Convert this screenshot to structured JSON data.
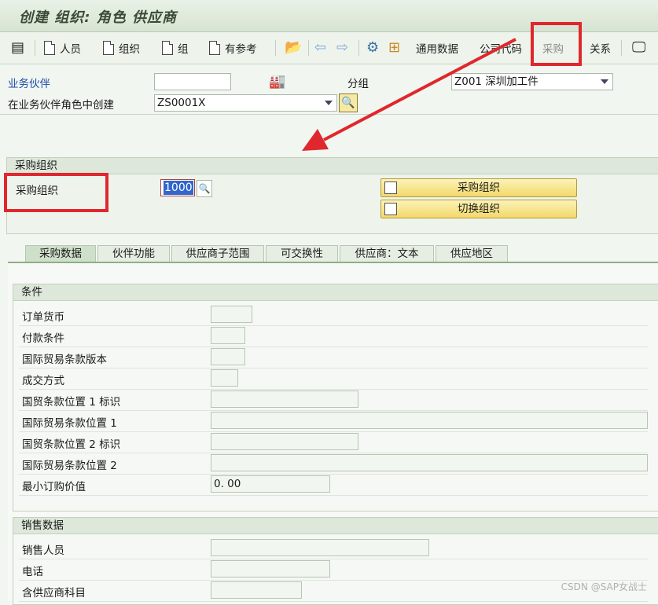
{
  "window": {
    "title": "创建 组织: 角色 供应商"
  },
  "toolbar": {
    "btn_person": "人员",
    "btn_org": "组织",
    "btn_group": "组",
    "btn_ref": "有参考",
    "tab_general": "通用数据",
    "tab_company": "公司代码",
    "tab_purchasing": "采购",
    "tab_relations": "关系"
  },
  "header": {
    "bp_label": "业务伙伴",
    "bp_value": "",
    "group_label": "分组",
    "group_value": "Z001 深圳加工件",
    "role_label": "在业务伙伴角色中创建",
    "role_value": "ZS0001X"
  },
  "purch_org_box": {
    "title": "采购组织",
    "field_label": "采购组织",
    "field_value": "1000",
    "btn_purch_org": "采购组织",
    "btn_switch_org": "切换组织"
  },
  "tabs": [
    {
      "label": "采购数据"
    },
    {
      "label": "伙伴功能"
    },
    {
      "label": "供应商子范围"
    },
    {
      "label": "可交换性"
    },
    {
      "label": "供应商：文本"
    },
    {
      "label": "供应地区"
    }
  ],
  "conditions": {
    "title": "条件",
    "rows": [
      {
        "label": "订单货币",
        "value": ""
      },
      {
        "label": "付款条件",
        "value": ""
      },
      {
        "label": "国际贸易条款版本",
        "value": ""
      },
      {
        "label": "成交方式",
        "value": ""
      },
      {
        "label": "国贸条款位置 1 标识",
        "value": ""
      },
      {
        "label": "国际贸易条款位置 1",
        "value": ""
      },
      {
        "label": "国贸条款位置 2 标识",
        "value": ""
      },
      {
        "label": "国际贸易条款位置 2",
        "value": ""
      },
      {
        "label": "最小订购价值",
        "value": "0. 00"
      }
    ]
  },
  "sales": {
    "title": "销售数据",
    "rows": [
      {
        "label": "销售人员",
        "value": ""
      },
      {
        "label": "电话",
        "value": ""
      },
      {
        "label": "含供应商科目",
        "value": ""
      }
    ]
  },
  "watermark": "CSDN @SAP女战士",
  "colors": {
    "annotation_red": "#e0272d",
    "button_yellow": "#f3d86a",
    "link_blue": "#1a4ba6"
  }
}
